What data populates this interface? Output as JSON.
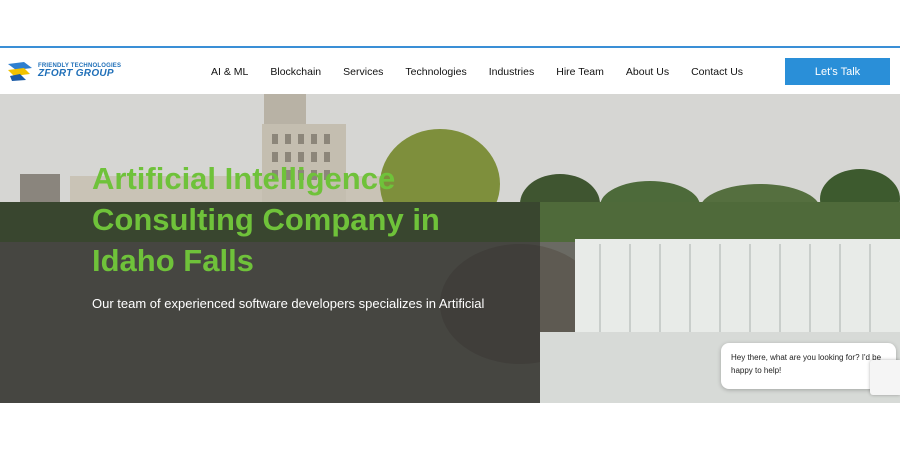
{
  "header": {
    "logo_top": "FRIENDLY TECHNOLOGIES",
    "logo_bottom": "ZFORT GROUP",
    "nav": [
      "AI & ML",
      "Blockchain",
      "Services",
      "Technologies",
      "Industries",
      "Hire Team",
      "About Us",
      "Contact Us"
    ],
    "cta_label": "Let's Talk"
  },
  "hero": {
    "title": "Artificial Intelligence Consulting Company in Idaho Falls",
    "subtitle": "Our team of experienced software developers specializes in Artificial"
  },
  "chat": {
    "message": "Hey there, what are you looking for? I'd be happy to help!"
  },
  "colors": {
    "accent": "#2a8fd8",
    "title_green": "#6fc23a",
    "header_border": "#3a8fd6"
  }
}
